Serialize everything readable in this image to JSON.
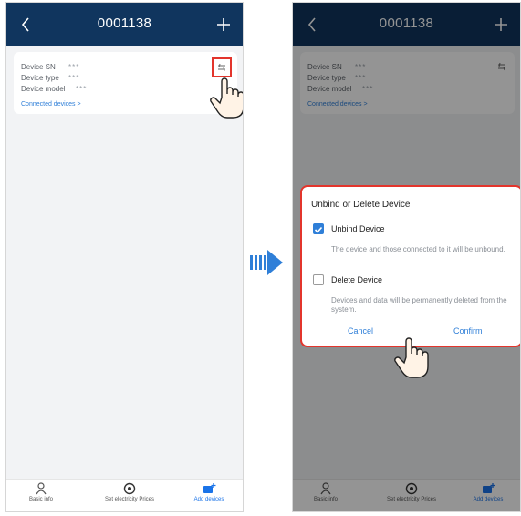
{
  "left": {
    "header": {
      "title": "0001138"
    },
    "card": {
      "rows": [
        {
          "label": "Device SN",
          "value": "***"
        },
        {
          "label": "Device type",
          "value": "***"
        },
        {
          "label": "Device model",
          "value": "***"
        }
      ],
      "link": "Connected devices >"
    },
    "tabs": [
      {
        "label": "Basic info",
        "icon": "person-icon"
      },
      {
        "label": "Set electricity Prices",
        "icon": "price-icon"
      },
      {
        "label": "Add devices",
        "icon": "add-device-icon"
      }
    ]
  },
  "right": {
    "header": {
      "title": "0001138"
    },
    "card": {
      "rows": [
        {
          "label": "Device SN",
          "value": "***"
        },
        {
          "label": "Device type",
          "value": "***"
        },
        {
          "label": "Device model",
          "value": "***"
        }
      ],
      "link": "Connected devices >"
    },
    "dialog": {
      "title": "Unbind or Delete Device",
      "options": [
        {
          "label": "Unbind Device",
          "checked": true,
          "desc": "The device and those connected to it will be unbound."
        },
        {
          "label": "Delete Device",
          "checked": false,
          "desc": "Devices and data will be permanently deleted from the system."
        }
      ],
      "cancel": "Cancel",
      "confirm": "Confirm"
    },
    "tabs": [
      {
        "label": "Basic info",
        "icon": "person-icon"
      },
      {
        "label": "Set electricity Prices",
        "icon": "price-icon"
      },
      {
        "label": "Add devices",
        "icon": "add-device-icon"
      }
    ]
  },
  "colors": {
    "navbar": "#10355e",
    "accent": "#2f7fd8",
    "highlight": "#e3352c"
  }
}
